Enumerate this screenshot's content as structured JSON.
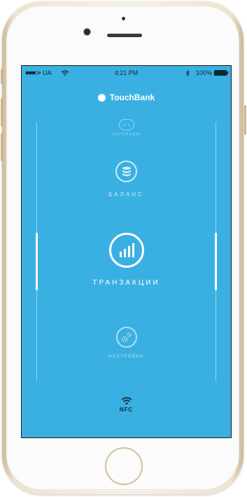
{
  "status_bar": {
    "carrier": "UA",
    "time": "4:21 PM",
    "battery": "100%"
  },
  "app": {
    "brand": "TouchBank"
  },
  "menu": {
    "items": [
      {
        "label": "ПЕРЕВОДЫ",
        "icon": "transfers-icon"
      },
      {
        "label": "БАЛАНС",
        "icon": "coins-icon"
      },
      {
        "label": "ТРАНЗАКЦИИ",
        "icon": "bar-chart-icon",
        "selected": true
      },
      {
        "label": "НАСТРОЙКИ",
        "icon": "gears-icon"
      }
    ]
  },
  "nfc": {
    "label": "NFC"
  },
  "colors": {
    "screen_bg": "#3ab0e2",
    "foreground": "#ffffff",
    "dark_text": "#0d2733",
    "frame_gold": "#d3c09a"
  }
}
